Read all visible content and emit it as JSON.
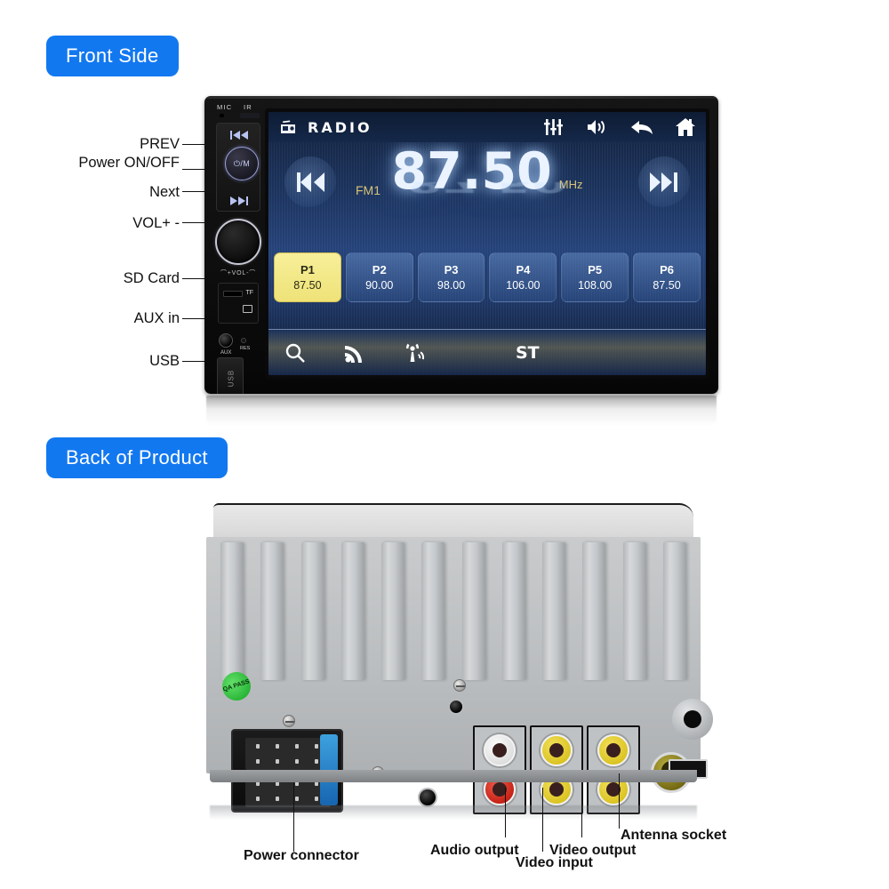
{
  "sections": {
    "front_badge": "Front Side",
    "back_badge": "Back of Product"
  },
  "front_callouts": [
    {
      "label": "PREV",
      "name": "callout-prev"
    },
    {
      "label": "Power ON/OFF",
      "name": "callout-power"
    },
    {
      "label": "Next",
      "name": "callout-next"
    },
    {
      "label": "VOL+ -",
      "name": "callout-vol"
    },
    {
      "label": "SD Card",
      "name": "callout-sd"
    },
    {
      "label": "AUX in",
      "name": "callout-aux"
    },
    {
      "label": "USB",
      "name": "callout-usb"
    }
  ],
  "front_unit": {
    "top_labels": {
      "mic": "MIC",
      "ir": "IR"
    },
    "power_button_label": "⏻/M",
    "vol_label": "⌒+VOL-⌒",
    "tf_label": "TF",
    "res_label": "RES",
    "aux_label": "AUX",
    "usb_label": "USB"
  },
  "screen": {
    "topbar": {
      "source_label": "RADIO",
      "icons": [
        "radio-icon",
        "equalizer-icon",
        "volume-icon",
        "back-icon",
        "home-icon"
      ]
    },
    "tuner": {
      "band": "FM1",
      "frequency": "87.50",
      "unit": "MHz",
      "prev_icon": "skip-backward-icon",
      "next_icon": "skip-forward-icon"
    },
    "presets": [
      {
        "num": "P1",
        "freq": "87.50",
        "active": true
      },
      {
        "num": "P2",
        "freq": "90.00",
        "active": false
      },
      {
        "num": "P3",
        "freq": "98.00",
        "active": false
      },
      {
        "num": "P4",
        "freq": "106.00",
        "active": false
      },
      {
        "num": "P5",
        "freq": "108.00",
        "active": false
      },
      {
        "num": "P6",
        "freq": "87.50",
        "active": false
      }
    ],
    "bottombar": {
      "icons": [
        "search-icon",
        "signal-icon",
        "antenna-scan-icon"
      ],
      "stereo_label": "ST"
    },
    "colors": {
      "accent_gold": "#d8c37a",
      "preset_active": "#efe278",
      "screen_blue": "#25437a"
    }
  },
  "back_unit": {
    "qc_sticker": "QA PASS",
    "fin_count": 12
  },
  "back_callouts": [
    {
      "label": "Power connector",
      "name": "callout-power-connector"
    },
    {
      "label": "Audio output",
      "name": "callout-audio-output"
    },
    {
      "label": "Video input",
      "name": "callout-video-input"
    },
    {
      "label": "Video output",
      "name": "callout-video-output"
    },
    {
      "label": "Antenna socket",
      "name": "callout-antenna-socket"
    }
  ],
  "theme": {
    "badge_blue": "#1278f0",
    "page_bg": "#ffffff"
  }
}
